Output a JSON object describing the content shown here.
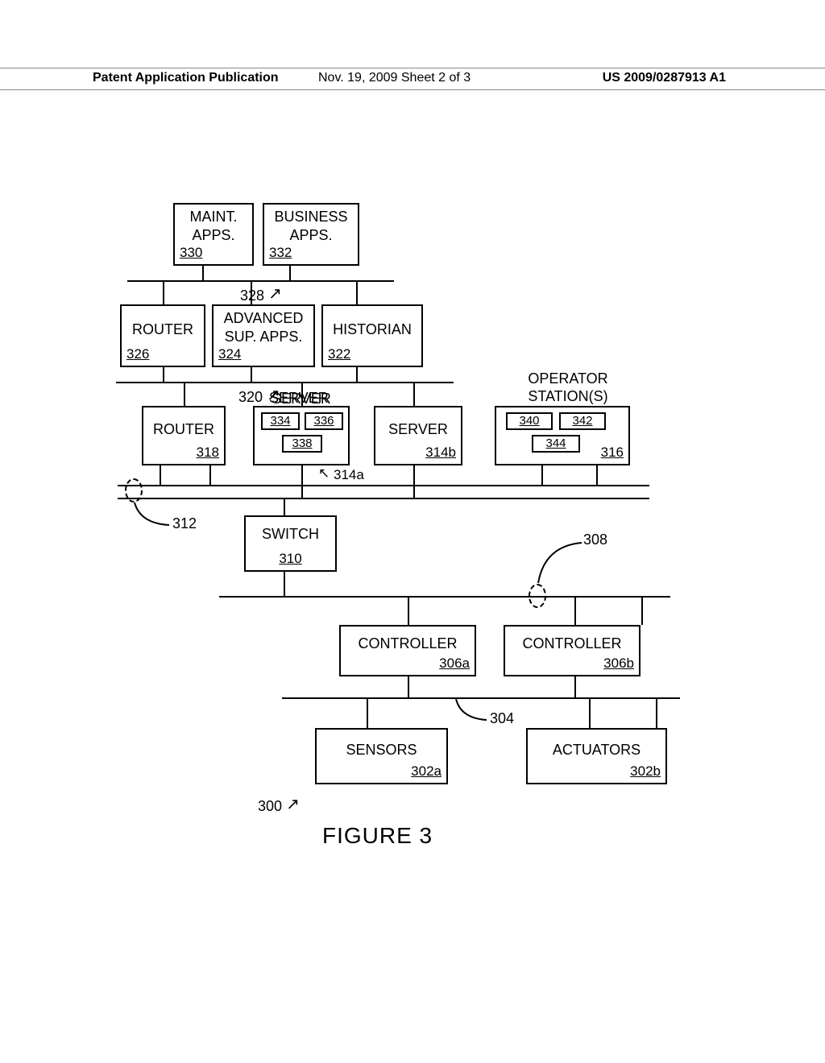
{
  "header": {
    "left": "Patent Application Publication",
    "mid": "Nov. 19, 2009  Sheet 2 of 3",
    "right": "US 2009/0287913 A1"
  },
  "figure": {
    "caption": "FIGURE 3",
    "overall_ref": "300"
  },
  "boxes": {
    "maint_apps": {
      "line1": "MAINT.",
      "line2": "APPS.",
      "ref": "330"
    },
    "business_apps": {
      "line1": "BUSINESS",
      "line2": "APPS.",
      "ref": "332"
    },
    "router_upper": {
      "label": "ROUTER",
      "ref": "326"
    },
    "adv_sup_apps": {
      "line1": "ADVANCED",
      "line2": "SUP. APPS.",
      "ref": "324"
    },
    "historian": {
      "label": "HISTORIAN",
      "ref": "322"
    },
    "router_lower": {
      "label": "ROUTER",
      "ref": "318"
    },
    "server_a": {
      "label": "SERVER",
      "ref": "338",
      "inner_left": "334",
      "inner_right": "336",
      "pointer": "314a"
    },
    "server_b": {
      "label": "SERVER",
      "ref": "314b"
    },
    "operator_stations": {
      "label": "OPERATOR\nSTATION(S)",
      "ref": "316",
      "inner_left": "340",
      "inner_right": "342",
      "inner_bottom": "344"
    },
    "switch": {
      "label": "SWITCH",
      "ref": "310"
    },
    "controller_a": {
      "label": "CONTROLLER",
      "ref": "306a"
    },
    "controller_b": {
      "label": "CONTROLLER",
      "ref": "306b"
    },
    "sensors": {
      "label": "SENSORS",
      "ref": "302a"
    },
    "actuators": {
      "label": "ACTUATORS",
      "ref": "302b"
    }
  },
  "bus_refs": {
    "bus_328": "328",
    "bus_320": "320",
    "bus_312": "312",
    "bus_308": "308",
    "bus_304": "304"
  }
}
